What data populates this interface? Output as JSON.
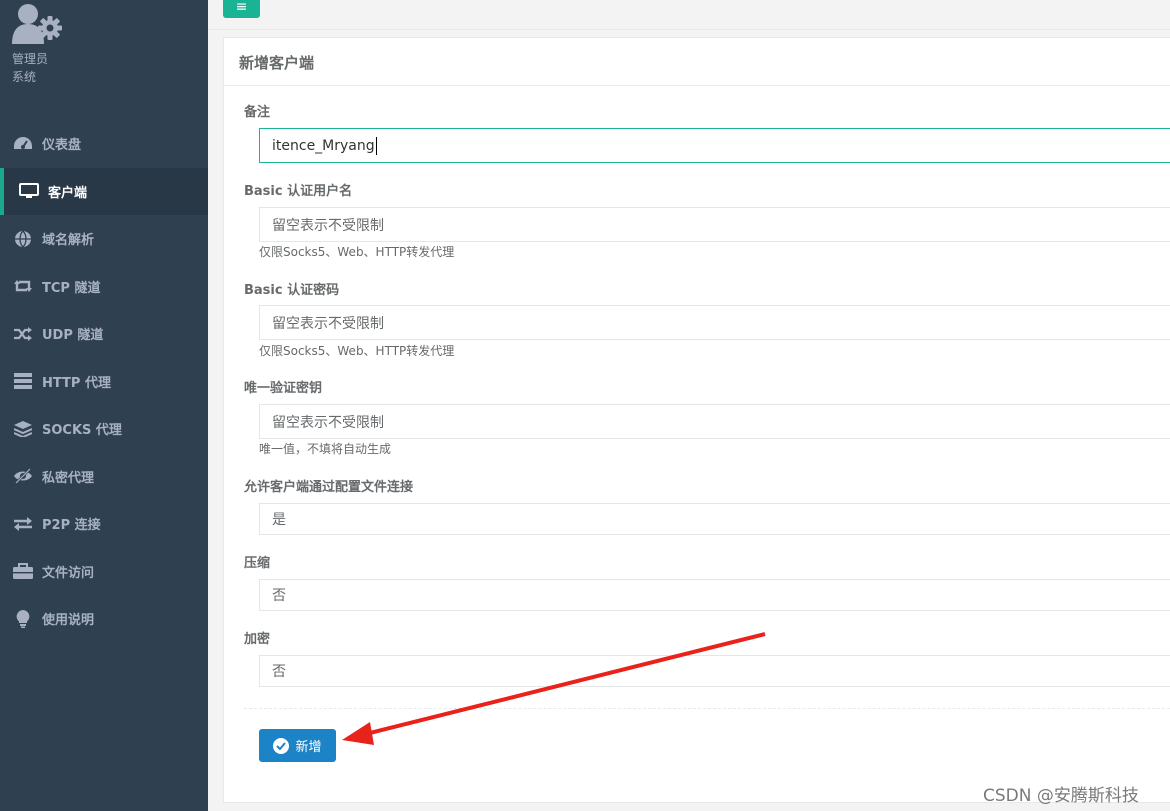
{
  "sidebar": {
    "profile": {
      "role": "管理员",
      "system": "系统"
    },
    "items": [
      {
        "label": "仪表盘",
        "icon": "dashboard-icon"
      },
      {
        "label": "客户端",
        "icon": "monitor-icon",
        "active": true
      },
      {
        "label": "域名解析",
        "icon": "globe-icon"
      },
      {
        "label": "TCP 隧道",
        "icon": "retweet-icon"
      },
      {
        "label": "UDP 隧道",
        "icon": "random-icon"
      },
      {
        "label": "HTTP 代理",
        "icon": "server-icon"
      },
      {
        "label": "SOCKS 代理",
        "icon": "layers-icon"
      },
      {
        "label": "私密代理",
        "icon": "eye-slash-icon"
      },
      {
        "label": "P2P 连接",
        "icon": "exchange-icon"
      },
      {
        "label": "文件访问",
        "icon": "briefcase-icon"
      },
      {
        "label": "使用说明",
        "icon": "lightbulb-icon"
      }
    ]
  },
  "toolbar": {
    "toggle_icon": "≡"
  },
  "panel": {
    "title": "新增客户端"
  },
  "form": {
    "remark": {
      "label": "备注",
      "value": "itence_Mryang"
    },
    "basic_user": {
      "label": "Basic 认证用户名",
      "placeholder": "留空表示不受限制",
      "help": "仅限Socks5、Web、HTTP转发代理"
    },
    "basic_pass": {
      "label": "Basic 认证密码",
      "placeholder": "留空表示不受限制",
      "help": "仅限Socks5、Web、HTTP转发代理"
    },
    "vkey": {
      "label": "唯一验证密钥",
      "placeholder": "留空表示不受限制",
      "help": "唯一值，不填将自动生成"
    },
    "config_conn": {
      "label": "允许客户端通过配置文件连接",
      "value": "是"
    },
    "compress": {
      "label": "压缩",
      "value": "否"
    },
    "crypt": {
      "label": "加密",
      "value": "否"
    }
  },
  "actions": {
    "add_label": "新增"
  },
  "watermark": "CSDN @安腾斯科技",
  "colors": {
    "sidebar": "#2f4050",
    "accent": "#1ab394",
    "primary_button": "#1c84c6",
    "annotation_arrow": "#e8231b"
  }
}
